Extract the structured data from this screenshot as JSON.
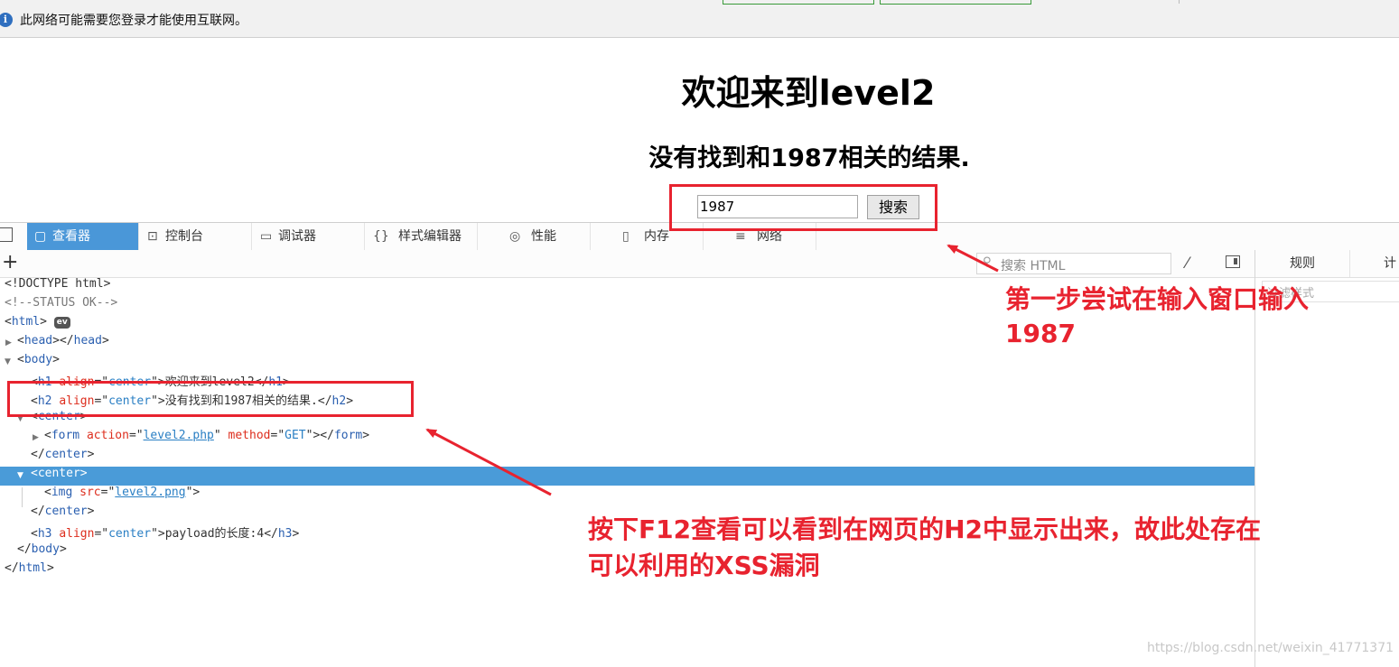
{
  "notification_bar": {
    "icon": "info-icon",
    "text": "此网络可能需要您登录才能使用互联网。"
  },
  "page": {
    "heading": "欢迎来到level2",
    "result_text": "没有找到和1987相关的结果.",
    "search_input_value": "1987",
    "search_button_label": "搜索"
  },
  "devtools": {
    "tabs": [
      {
        "label": "查看器",
        "icon": "inspector-icon",
        "active": true
      },
      {
        "label": "控制台",
        "icon": "console-icon"
      },
      {
        "label": "调试器",
        "icon": "debugger-icon"
      },
      {
        "label": "样式编辑器",
        "icon": "style-editor-icon"
      },
      {
        "label": "性能",
        "icon": "performance-icon"
      },
      {
        "label": "内存",
        "icon": "memory-icon"
      },
      {
        "label": "网络",
        "icon": "network-icon"
      }
    ],
    "search_placeholder": "搜索 HTML",
    "side_tabs": [
      "规则",
      "计"
    ],
    "side_filter_placeholder": "过滤样式",
    "markup": {
      "doctype": "<!DOCTYPE html>",
      "comment": "<!--STATUS OK-->",
      "h1_text": "欢迎来到level2",
      "h2_text": "没有找到和1987相关的结果.",
      "form_action": "level2.php",
      "form_method": "GET",
      "img_src": "level2.png",
      "h3_text": "payload的长度:4",
      "ev_badge": "ev",
      "align_value": "center"
    }
  },
  "annotations": {
    "note_step1_line1": "第一步尝试在输入窗口输入",
    "note_step1_line2": "1987",
    "note_f12_line1": "按下F12查看可以看到在网页的H2中显示出来，故此处存在",
    "note_f12_line2": "可以利用的XSS漏洞",
    "color": "#e8232f"
  },
  "watermark": "https://blog.csdn.net/weixin_41771371"
}
